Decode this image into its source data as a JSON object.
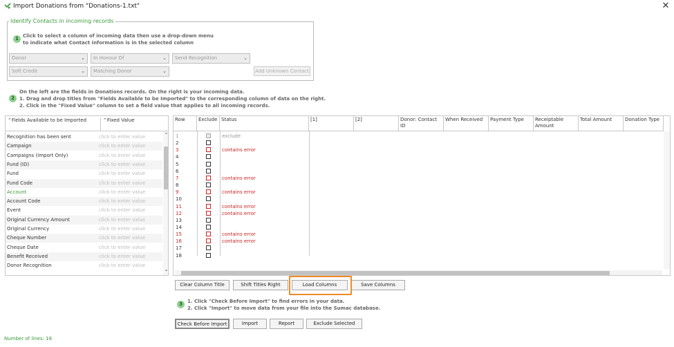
{
  "window": {
    "title": "Import Donations from \"Donations-1.txt\"",
    "close_glyph": "✕"
  },
  "identify": {
    "legend": "Identify Contacts in incoming records",
    "step": "1",
    "line1": "Click to select a column of incoming data then use a drop-down menu",
    "line2": "to indicate what Contact information is in the selected column",
    "dropdowns": [
      "Donor",
      "In Honour Of",
      "Send Recognition",
      "Soft Credit",
      "Matching Donor"
    ],
    "add_unknown": "Add Unknown Contact"
  },
  "fields_instr": {
    "step": "2",
    "line1": "On the left are the fields in Donations records. On the right is your incoming data.",
    "line2": "1. Drag and drop titles from \"Fields Available to be Imported\" to the corresponding column of data on the right.",
    "line3": "2. Click in the \"Fixed Value\" column to set a field value that applies to all incoming records."
  },
  "left_panel": {
    "col1": "⌃Fields Available to be Imported",
    "col2": "⌃Fixed Value",
    "placeholder": "click to enter value",
    "fields": [
      "Recognition has been sent",
      "Campaign",
      "Campaigns (Import Only)",
      "Fund (ID)",
      "Fund",
      "Fund Code",
      "Account",
      "Account Code",
      "Event",
      "Original Currency Amount",
      "Original Currency",
      "Cheque Number",
      "Cheque Date",
      "Benefit Received",
      "Donor Recognition"
    ],
    "highlight_field": "Account"
  },
  "grid": {
    "headers": [
      "Row",
      "Exclude",
      "Status",
      "[1]",
      "[2]",
      "Donor: Contact ID",
      "When Received",
      "Payment Type",
      "Receiptable Amount",
      "Total Amount",
      "Donation Type"
    ],
    "rows": [
      {
        "n": "1",
        "status": "exclude",
        "kind": "excluded"
      },
      {
        "n": "2",
        "status": "",
        "kind": "ok"
      },
      {
        "n": "3",
        "status": "contains error",
        "kind": "error"
      },
      {
        "n": "4",
        "status": "",
        "kind": "ok"
      },
      {
        "n": "5",
        "status": "",
        "kind": "ok"
      },
      {
        "n": "6",
        "status": "",
        "kind": "ok"
      },
      {
        "n": "7",
        "status": "contains error",
        "kind": "error"
      },
      {
        "n": "8",
        "status": "",
        "kind": "ok"
      },
      {
        "n": "9",
        "status": "contains error",
        "kind": "error"
      },
      {
        "n": "10",
        "status": "",
        "kind": "ok"
      },
      {
        "n": "11",
        "status": "contains error",
        "kind": "error"
      },
      {
        "n": "12",
        "status": "contains error",
        "kind": "error"
      },
      {
        "n": "13",
        "status": "",
        "kind": "ok"
      },
      {
        "n": "14",
        "status": "",
        "kind": "ok"
      },
      {
        "n": "15",
        "status": "contains error",
        "kind": "error"
      },
      {
        "n": "16",
        "status": "contains error",
        "kind": "error"
      },
      {
        "n": "17",
        "status": "",
        "kind": "ok"
      },
      {
        "n": "18",
        "status": "",
        "kind": "ok"
      }
    ]
  },
  "column_buttons": {
    "clear": "Clear Column Title",
    "shift": "Shift Titles Right",
    "load": "Load Columns",
    "save": "Save Columns"
  },
  "import_instr": {
    "step": "3",
    "line1": "1. Click \"Check Before Import\" to find errors in your data.",
    "line2": "2. Click \"Import\" to move data from your file into the Sumac database."
  },
  "action_buttons": {
    "check": "Check Before Import",
    "import": "Import",
    "report": "Report",
    "exclude": "Exclude Selected"
  },
  "footer": "Number of lines: 18",
  "colors": {
    "accent": "#3a9a3a",
    "error": "#cc2222",
    "highlight": "#f08a24"
  }
}
